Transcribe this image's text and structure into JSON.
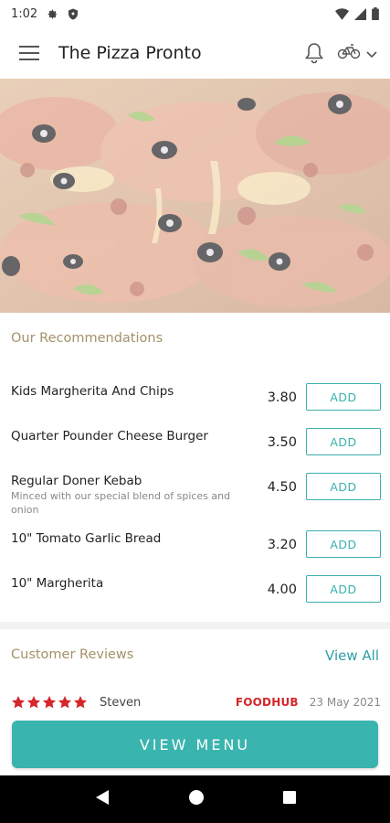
{
  "status_bar": {
    "time": "1:02",
    "icons": [
      "gear-icon",
      "shield-icon",
      "wifi-icon",
      "signal-icon",
      "battery-icon"
    ]
  },
  "app_bar": {
    "title": "The Pizza Pronto",
    "icons": [
      "hamburger-menu-icon",
      "bell-icon",
      "bicycle-icon",
      "chevron-down-icon"
    ]
  },
  "hero": {
    "image": "pizza-photo"
  },
  "recommendations": {
    "title": "Our Recommendations",
    "items": [
      {
        "name": "Kids Margherita And Chips",
        "description": "",
        "price": "3.80",
        "add_label": "ADD"
      },
      {
        "name": "Quarter Pounder Cheese Burger",
        "description": "",
        "price": "3.50",
        "add_label": "ADD"
      },
      {
        "name": "Regular Doner Kebab",
        "description": "Minced with our special blend of spices and onion",
        "price": "4.50",
        "add_label": "ADD"
      },
      {
        "name": "10\" Tomato Garlic Bread",
        "description": "",
        "price": "3.20",
        "add_label": "ADD"
      },
      {
        "name": "10\" Margherita",
        "description": "",
        "price": "4.00",
        "add_label": "ADD"
      }
    ]
  },
  "reviews": {
    "title": "Customer Reviews",
    "view_all_label": "View All",
    "items": [
      {
        "rating": 5,
        "reviewer": "Steven",
        "source": "FOODHUB",
        "date": "23 May 2021"
      }
    ]
  },
  "view_menu_label": "VIEW MENU",
  "colors": {
    "accent": "#39b4ae",
    "section_title": "#a4916a",
    "star": "#d4262b",
    "source_brand": "#d4262b"
  },
  "nav_bar": {
    "icons": [
      "back-icon",
      "home-icon",
      "recents-icon"
    ]
  }
}
